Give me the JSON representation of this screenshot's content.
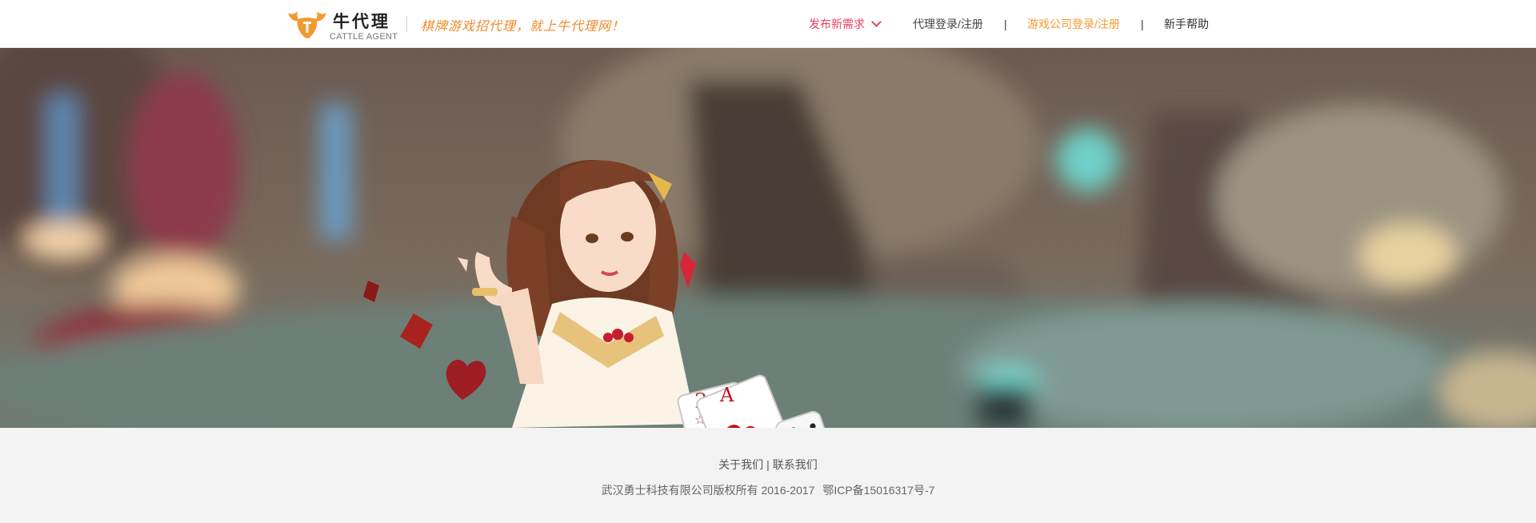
{
  "header": {
    "logo": {
      "name": "牛代理",
      "subtitle": "CATTLE AGENT"
    },
    "slogan": "棋牌游戏招代理，就上牛代理网！",
    "nav": {
      "publish": "发布新需求",
      "agent_login": "代理登录/注册",
      "separator": "|",
      "company_login": "游戏公司登录/注册",
      "help": "新手帮助"
    }
  },
  "banner": {
    "cards": {
      "rank_one": "2",
      "rank_two": "A"
    }
  },
  "footer": {
    "about": "关于我们",
    "divider": "|",
    "contact": "联系我们",
    "copyright": "武汉勇士科技有限公司版权所有 2016-2017",
    "icp": "鄂ICP备15016317号-7"
  },
  "colors": {
    "brand_orange": "#f39a30",
    "accent_pink": "#e8405f",
    "header_bg": "#ffffff",
    "footer_bg": "#f3f3f3"
  },
  "icons": [
    "bull-logo-icon",
    "chevron-down-icon",
    "playing-card-icon",
    "dice-icon",
    "diamond-icon",
    "heart-icon"
  ]
}
